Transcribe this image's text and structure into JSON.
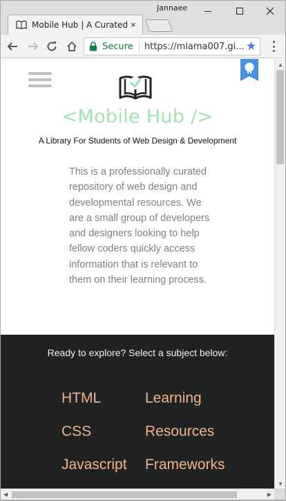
{
  "window": {
    "user_name": "Jannaee",
    "tab_title": "Mobile Hub | A Curated C",
    "close_tab_glyph": "×"
  },
  "toolbar": {
    "secure_label": "Secure",
    "url": "https://mlama007.gi..."
  },
  "page": {
    "title": "<Mobile Hub />",
    "subtitle": "A Library For Students of Web Design & Development",
    "about": "This is a professionally curated repository of web design and developmental resources. We are a small group of developers and designers looking to help fellow coders quickly access information that is relevant to them on their learning process.",
    "explore_heading": "Ready to explore? Select a subject below:",
    "subjects": [
      "HTML",
      "Learning",
      "CSS",
      "Resources",
      "Javascript",
      "Frameworks"
    ]
  },
  "colors": {
    "title_green": "#9ee3b0",
    "subject_orange": "#efb48d",
    "dark_section": "#212222",
    "ribbon_blue": "#4a90e2",
    "secure_green": "#0b8043"
  },
  "icons": {
    "back": "arrow-left-icon",
    "forward": "arrow-right-icon",
    "reload": "reload-icon",
    "home": "home-icon",
    "lock": "lock-icon",
    "star": "star-icon",
    "menu": "menu-dots-icon",
    "logo": "open-book-check-icon",
    "github": "github-octocat-icon",
    "hamburger": "hamburger-menu-icon"
  }
}
